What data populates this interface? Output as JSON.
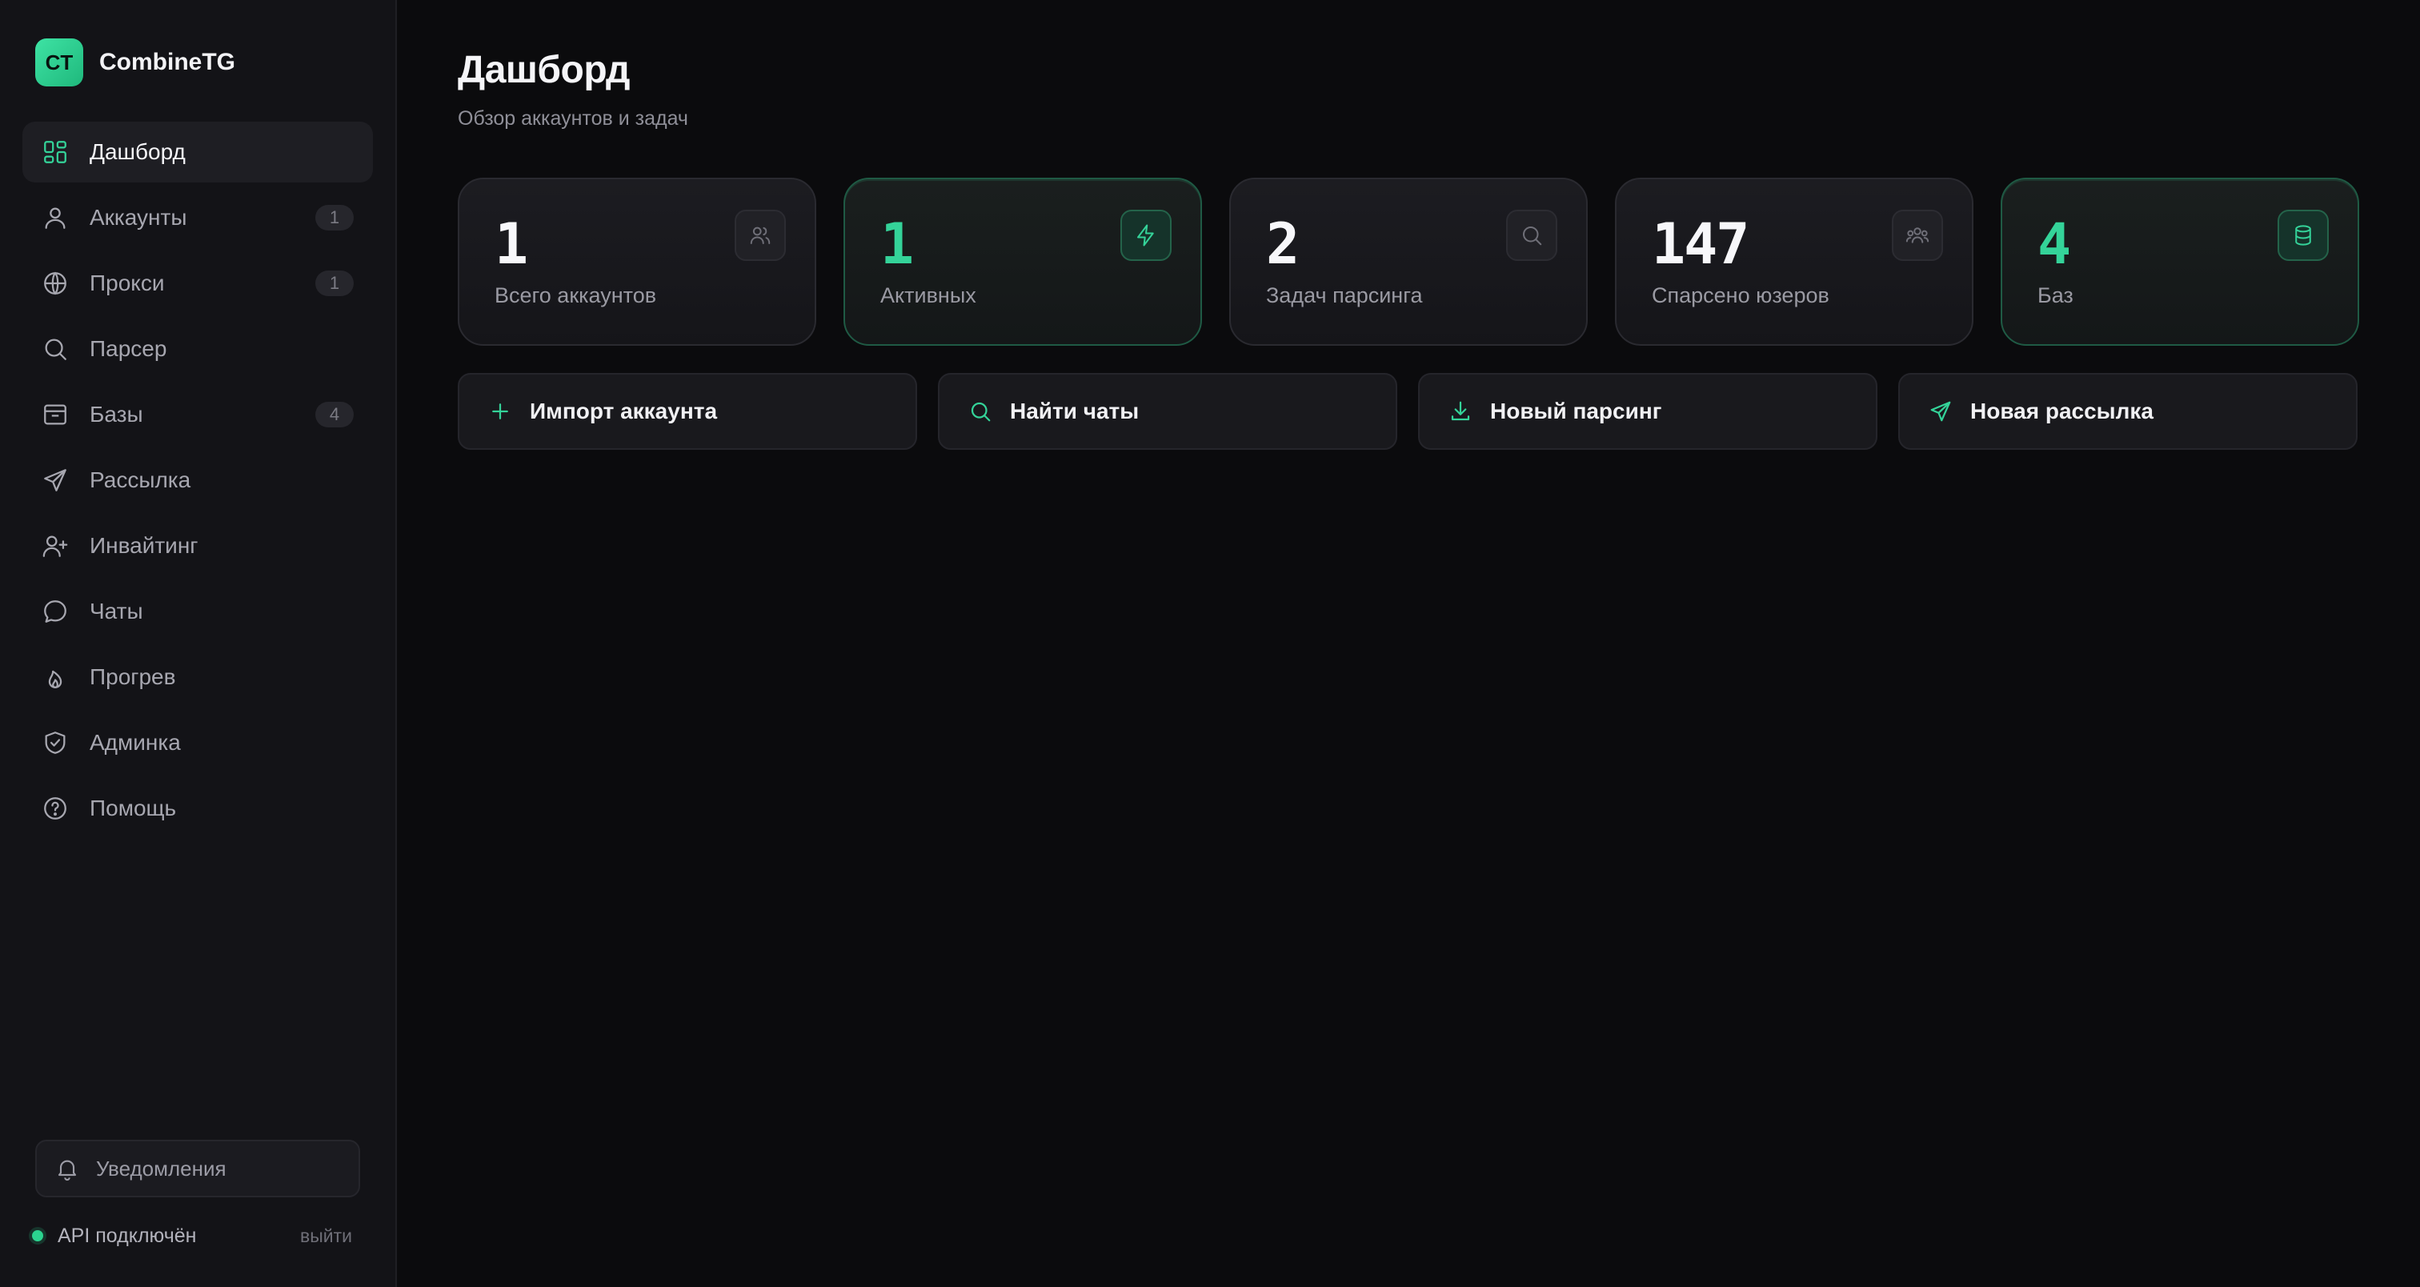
{
  "app": {
    "logo_text": "CT",
    "name": "CombineTG"
  },
  "sidebar": {
    "items": [
      {
        "label": "Дашборд",
        "icon": "dashboard-icon",
        "active": true,
        "badge": null
      },
      {
        "label": "Аккаунты",
        "icon": "user-icon",
        "active": false,
        "badge": "1"
      },
      {
        "label": "Прокси",
        "icon": "globe-icon",
        "active": false,
        "badge": "1"
      },
      {
        "label": "Парсер",
        "icon": "search-icon",
        "active": false,
        "badge": null
      },
      {
        "label": "Базы",
        "icon": "archive-icon",
        "active": false,
        "badge": "4"
      },
      {
        "label": "Рассылка",
        "icon": "send-icon",
        "active": false,
        "badge": null
      },
      {
        "label": "Инвайтинг",
        "icon": "user-plus-icon",
        "active": false,
        "badge": null
      },
      {
        "label": "Чаты",
        "icon": "chat-icon",
        "active": false,
        "badge": null
      },
      {
        "label": "Прогрев",
        "icon": "flame-icon",
        "active": false,
        "badge": null
      },
      {
        "label": "Админка",
        "icon": "shield-icon",
        "active": false,
        "badge": null
      },
      {
        "label": "Помощь",
        "icon": "help-icon",
        "active": false,
        "badge": null
      }
    ],
    "notifications_label": "Уведомления",
    "api_status": "API подключён",
    "logout_label": "выйти"
  },
  "main": {
    "title": "Дашборд",
    "subtitle": "Обзор аккаунтов и задач",
    "stats": [
      {
        "value": "1",
        "label": "Всего аккаунтов",
        "icon": "users-icon",
        "accent": false
      },
      {
        "value": "1",
        "label": "Активных",
        "icon": "lightning-icon",
        "accent": true
      },
      {
        "value": "2",
        "label": "Задач парсинга",
        "icon": "search-icon",
        "accent": false
      },
      {
        "value": "147",
        "label": "Спарсено юзеров",
        "icon": "users-group-icon",
        "accent": false
      },
      {
        "value": "4",
        "label": "Баз",
        "icon": "database-icon",
        "accent": true
      }
    ],
    "actions": [
      {
        "label": "Импорт аккаунта",
        "icon": "plus-icon"
      },
      {
        "label": "Найти чаты",
        "icon": "search-icon"
      },
      {
        "label": "Новый парсинг",
        "icon": "download-icon"
      },
      {
        "label": "Новая рассылка",
        "icon": "send-icon"
      }
    ]
  },
  "colors": {
    "accent": "#34d399",
    "background": "#0b0b0d",
    "sidebar": "#131317",
    "card": "#1a1a1f",
    "muted_text": "#9a9aa3"
  }
}
